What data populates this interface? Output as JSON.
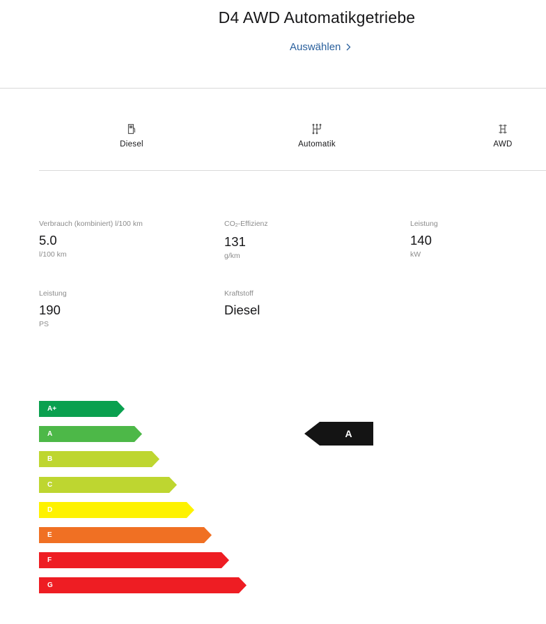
{
  "header": {
    "title": "D4 AWD Automatikgetriebe",
    "select_label": "Auswählen"
  },
  "features": [
    {
      "label": "Diesel",
      "icon": "fuel-pump-icon"
    },
    {
      "label": "Automatik",
      "icon": "gear-shift-icon"
    },
    {
      "label": "AWD",
      "icon": "all-wheel-drive-icon"
    }
  ],
  "specs": [
    {
      "label": "Verbrauch (kombiniert) l/100 km",
      "value": "5.0",
      "unit": "l/100 km"
    },
    {
      "label_prefix": "CO",
      "label_sub": "2",
      "label_suffix": "-Effizienz",
      "value": "131",
      "unit": "g/km"
    },
    {
      "label": "Leistung",
      "value": "140",
      "unit": "kW"
    },
    {
      "label": "Leistung",
      "value": "190",
      "unit": "PS"
    },
    {
      "label": "Kraftstoff",
      "value": "Diesel",
      "unit": ""
    }
  ],
  "efficiency": {
    "classes": [
      {
        "label": "A+",
        "color": "#0aa04f"
      },
      {
        "label": "A",
        "color": "#4db848"
      },
      {
        "label": "B",
        "color": "#bed630"
      },
      {
        "label": "C",
        "color": "#bed630"
      },
      {
        "label": "D",
        "color": "#fef200"
      },
      {
        "label": "E",
        "color": "#f07023"
      },
      {
        "label": "F",
        "color": "#ee1d23"
      },
      {
        "label": "G",
        "color": "#ee1d23"
      }
    ],
    "rating": "A",
    "marker_color": "#141414"
  }
}
